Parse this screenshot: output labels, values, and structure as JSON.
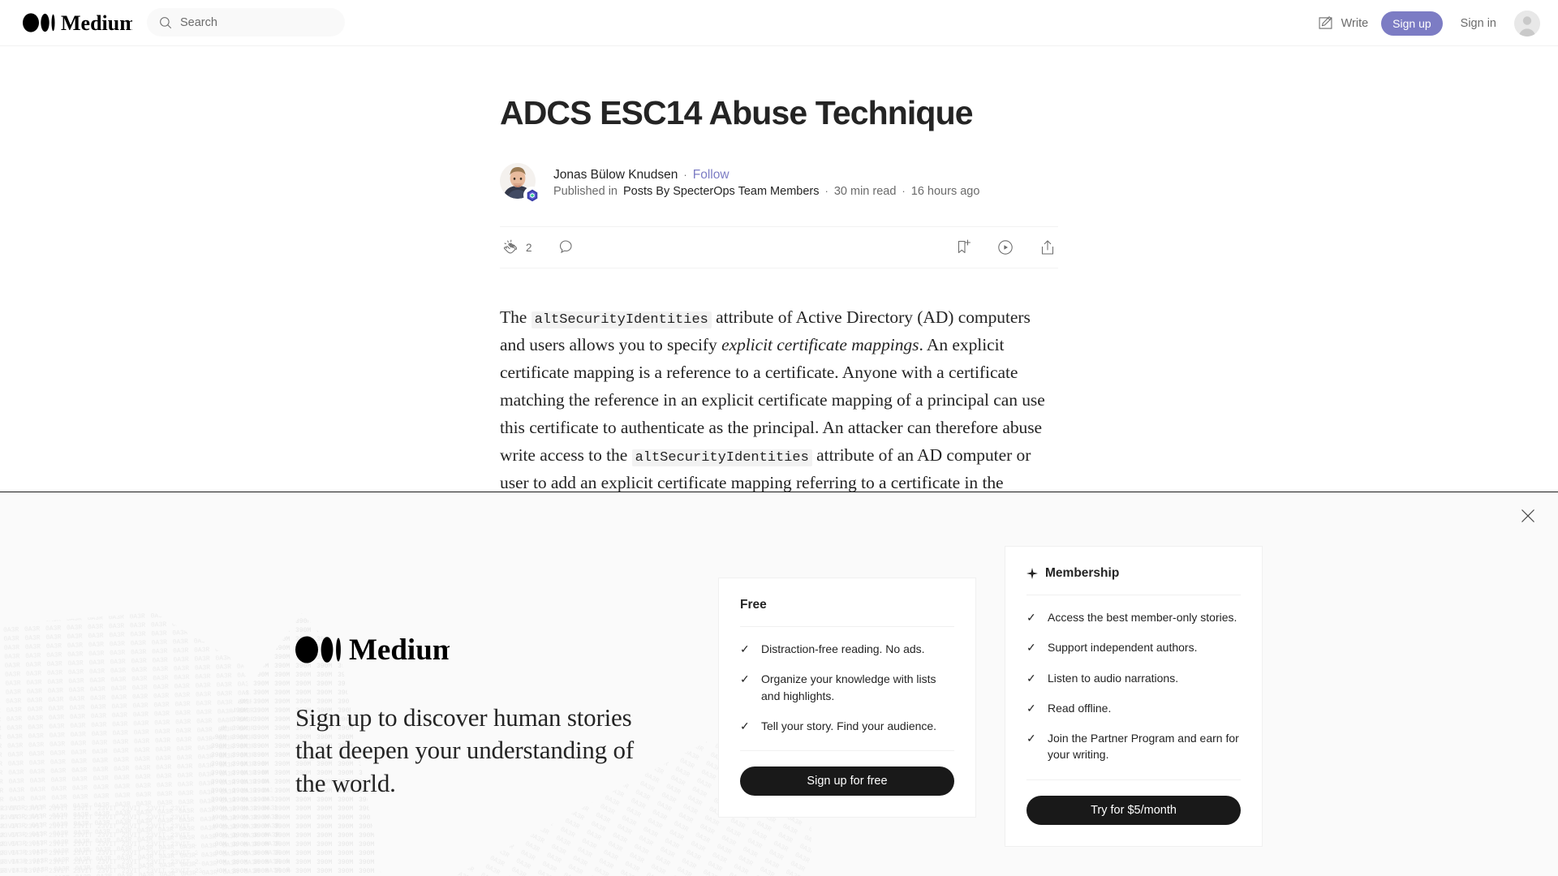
{
  "header": {
    "brand": "Medium",
    "search": {
      "placeholder": "Search",
      "value": ""
    },
    "write_label": "Write",
    "signup_label": "Sign up",
    "signin_label": "Sign in",
    "icons": {
      "search": "search-icon",
      "write": "write-pencil-icon",
      "avatar": "user-avatar-icon"
    },
    "accent_color": "#7c7cc4"
  },
  "article": {
    "title": "ADCS ESC14 Abuse Technique",
    "author": "Jonas Bülow Knudsen",
    "follow_label": "Follow",
    "published_in_prefix": "Published in",
    "publication": "Posts By SpecterOps Team Members",
    "read_time": "30 min read",
    "published_ago": "16 hours ago",
    "separator": "·",
    "actions": {
      "clap_count": "2",
      "clap_icon": "clap-icon",
      "comment_icon": "comment-icon",
      "bookmark_icon": "bookmark-add-icon",
      "listen_icon": "listen-play-icon",
      "share_icon": "share-icon"
    },
    "body": {
      "seg1": "The ",
      "code1": "altSecurityIdentities",
      "seg2": " attribute of Active Directory (AD) computers and users allows you to specify ",
      "em1": "explicit certificate mappings",
      "seg3": ". An explicit certificate mapping is a reference to a certificate. Anyone with a certificate matching the reference in an explicit certificate mapping of a principal can use this certificate to authenticate as the principal. An attacker can therefore abuse write access to the ",
      "code2": "altSecurityIdentities",
      "seg4": " attribute of an AD computer or user to add an explicit certificate mapping referring to a certificate in the attacker’s possession, and then use this certificate to authenticate as the said"
    }
  },
  "banner": {
    "close_icon": "close-icon",
    "brand": "Medium",
    "headline": "Sign up to discover human stories that deepen your understanding of the world.",
    "free_card": {
      "title": "Free",
      "items": [
        "Distraction-free reading. No ads.",
        "Organize your knowledge with lists and highlights.",
        "Tell your story. Find your audience."
      ],
      "cta": "Sign up for free"
    },
    "membership_card": {
      "title": "Membership",
      "title_icon": "sparkle-icon",
      "items": [
        "Access the best member-only stories.",
        "Support independent authors.",
        "Listen to audio narrations.",
        "Read offline.",
        "Join the Partner Program and earn for your writing."
      ],
      "cta": "Try for $5/month"
    },
    "check_glyph": "✓",
    "background_color": "#fafafa"
  }
}
